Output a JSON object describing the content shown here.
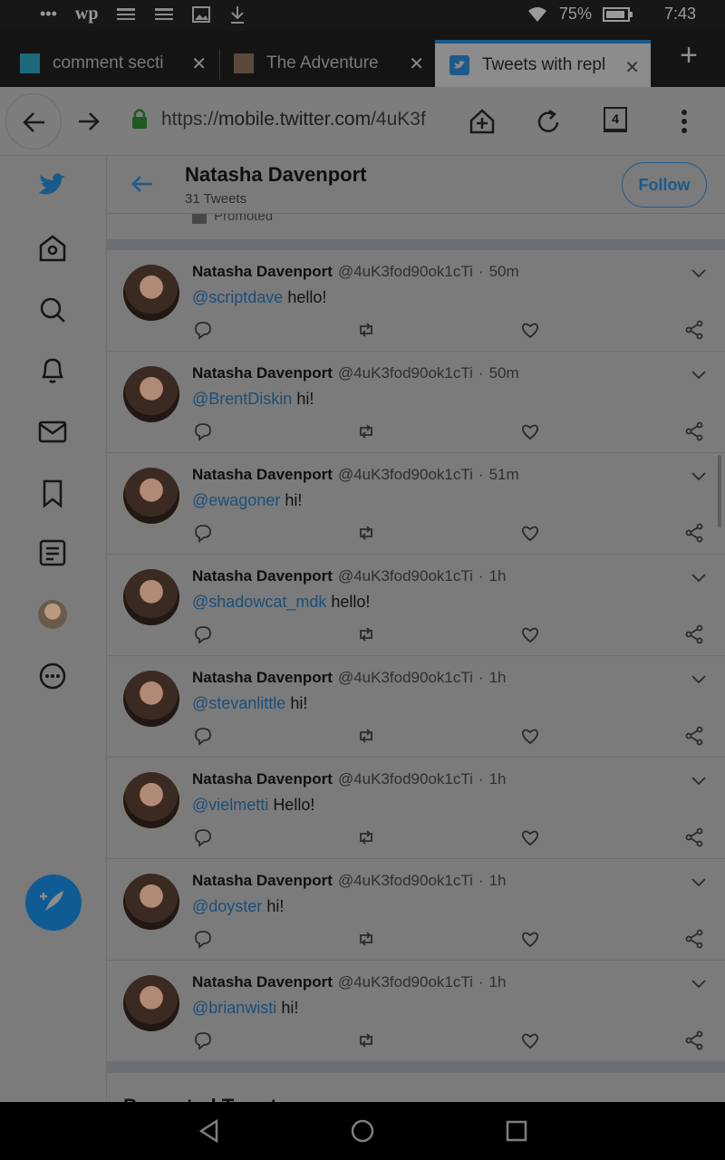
{
  "status_bar": {
    "battery_pct": "75%",
    "time": "7:43",
    "icons": [
      "more-icon",
      "wp-icon",
      "news-icon",
      "news-icon",
      "image-icon",
      "download-icon",
      "wifi-icon",
      "battery-icon"
    ]
  },
  "browser": {
    "tabs": [
      {
        "title": "comment secti",
        "active": false
      },
      {
        "title": "The Adventure",
        "active": false
      },
      {
        "title": "Tweets with repl",
        "active": true
      }
    ],
    "url_prefix": "https://",
    "url_domain": "mobile.twitter.com",
    "url_path": "/4uK3f",
    "tab_count": "4"
  },
  "profile": {
    "name": "Natasha Davenport",
    "tweet_count": "31 Tweets",
    "follow_label": "Follow",
    "promoted_label": "Promoted"
  },
  "tweets": [
    {
      "name": "Natasha Davenport",
      "handle": "@4uK3fod90ok1cTi",
      "time": "50m",
      "mention": "@scriptdave",
      "text": "hello!"
    },
    {
      "name": "Natasha Davenport",
      "handle": "@4uK3fod90ok1cTi",
      "time": "50m",
      "mention": "@BrentDiskin",
      "text": "hi!"
    },
    {
      "name": "Natasha Davenport",
      "handle": "@4uK3fod90ok1cTi",
      "time": "51m",
      "mention": "@ewagoner",
      "text": "hi!"
    },
    {
      "name": "Natasha Davenport",
      "handle": "@4uK3fod90ok1cTi",
      "time": "1h",
      "mention": "@shadowcat_mdk",
      "text": "hello!"
    },
    {
      "name": "Natasha Davenport",
      "handle": "@4uK3fod90ok1cTi",
      "time": "1h",
      "mention": "@stevanlittle",
      "text": "hi!"
    },
    {
      "name": "Natasha Davenport",
      "handle": "@4uK3fod90ok1cTi",
      "time": "1h",
      "mention": "@vielmetti",
      "text": "Hello!"
    },
    {
      "name": "Natasha Davenport",
      "handle": "@4uK3fod90ok1cTi",
      "time": "1h",
      "mention": "@doyster",
      "text": "hi!"
    },
    {
      "name": "Natasha Davenport",
      "handle": "@4uK3fod90ok1cTi",
      "time": "1h",
      "mention": "@brianwisti",
      "text": "hi!"
    }
  ],
  "promoted_section_title": "Promoted Tweet",
  "colors": {
    "accent": "#1b5a8c",
    "link": "#1b4e78",
    "overlay": "#7b7b7b"
  }
}
